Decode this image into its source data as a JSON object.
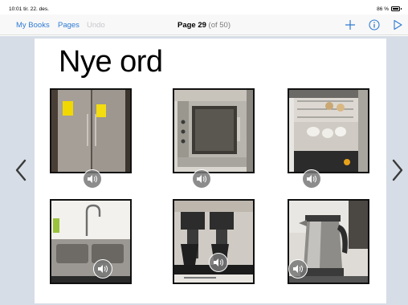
{
  "status": {
    "time": "10:01",
    "date": "tir. 22. des.",
    "battery": "86 %"
  },
  "toolbar": {
    "my_books": "My Books",
    "pages": "Pages",
    "undo": "Undo",
    "page_label": "Page 29",
    "page_of": "(of 50)",
    "icons": [
      "plus-icon",
      "info-icon",
      "play-icon"
    ],
    "accent_color": "#2f7bd4"
  },
  "page": {
    "heading": "Nye ord",
    "tiles": [
      {
        "name": "refrigerator",
        "icon": "sound-icon"
      },
      {
        "name": "oven",
        "icon": "sound-icon"
      },
      {
        "name": "dishwasher",
        "icon": "sound-icon"
      },
      {
        "name": "sink",
        "icon": "sound-icon"
      },
      {
        "name": "coffee-maker",
        "icon": "sound-icon"
      },
      {
        "name": "kettle",
        "icon": "sound-icon"
      }
    ]
  },
  "navigation": {
    "icons": [
      "chevron-left-icon",
      "chevron-right-icon"
    ]
  }
}
